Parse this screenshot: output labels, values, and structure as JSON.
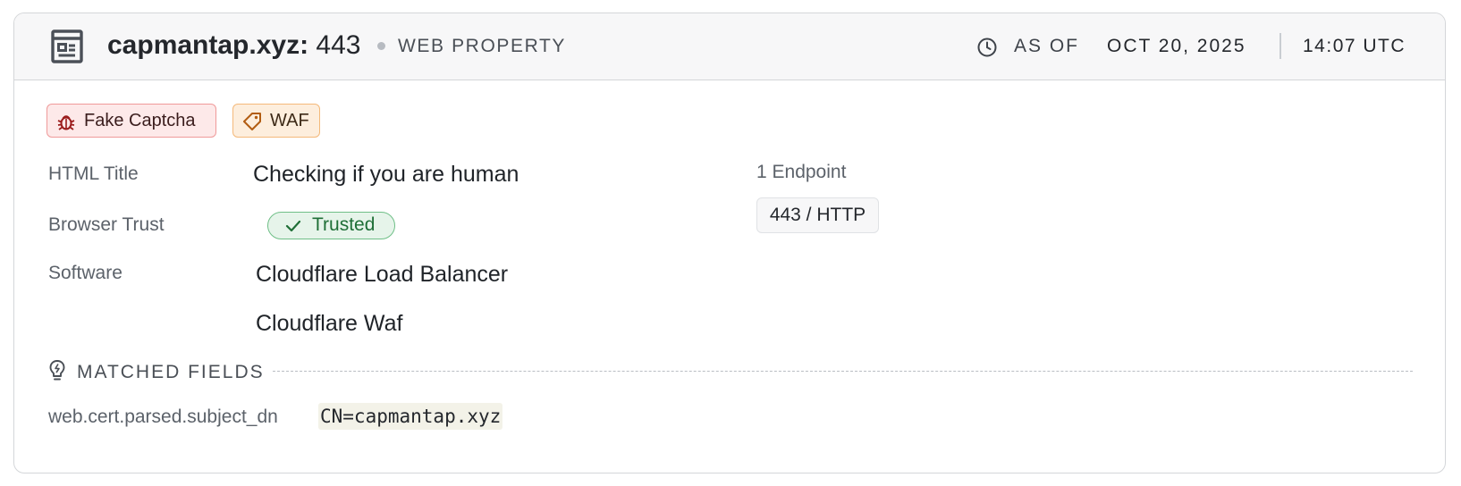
{
  "header": {
    "icon": "web-property-icon",
    "host": "capmantap.xyz:",
    "port": "443",
    "type_label": "WEB PROPERTY",
    "clock_icon": "clock-icon",
    "as_of_label": "AS OF",
    "date": "OCT 20, 2025",
    "time": "14:07 UTC"
  },
  "tags": [
    {
      "label": "Fake Captcha",
      "icon": "bug-icon",
      "color": "#fde9e9"
    },
    {
      "label": "WAF",
      "icon": "tag-icon",
      "color": "#fdeedd"
    }
  ],
  "details": {
    "html_title_label": "HTML Title",
    "html_title_value": "Checking if you are human",
    "browser_trust_label": "Browser Trust",
    "browser_trust_value": "Trusted",
    "browser_trust_icon": "check-icon",
    "browser_trust_color": "#1f6f37",
    "software_label": "Software",
    "software": [
      "Cloudflare Load Balancer",
      "Cloudflare Waf"
    ]
  },
  "endpoints": {
    "count_label": "1 Endpoint",
    "items": [
      "443 / HTTP"
    ]
  },
  "matched_fields": {
    "icon": "lightbulb-icon",
    "title": "MATCHED FIELDS",
    "rows": [
      {
        "field": "web.cert.parsed.subject_dn",
        "value": "CN=capmantap.xyz"
      }
    ]
  }
}
